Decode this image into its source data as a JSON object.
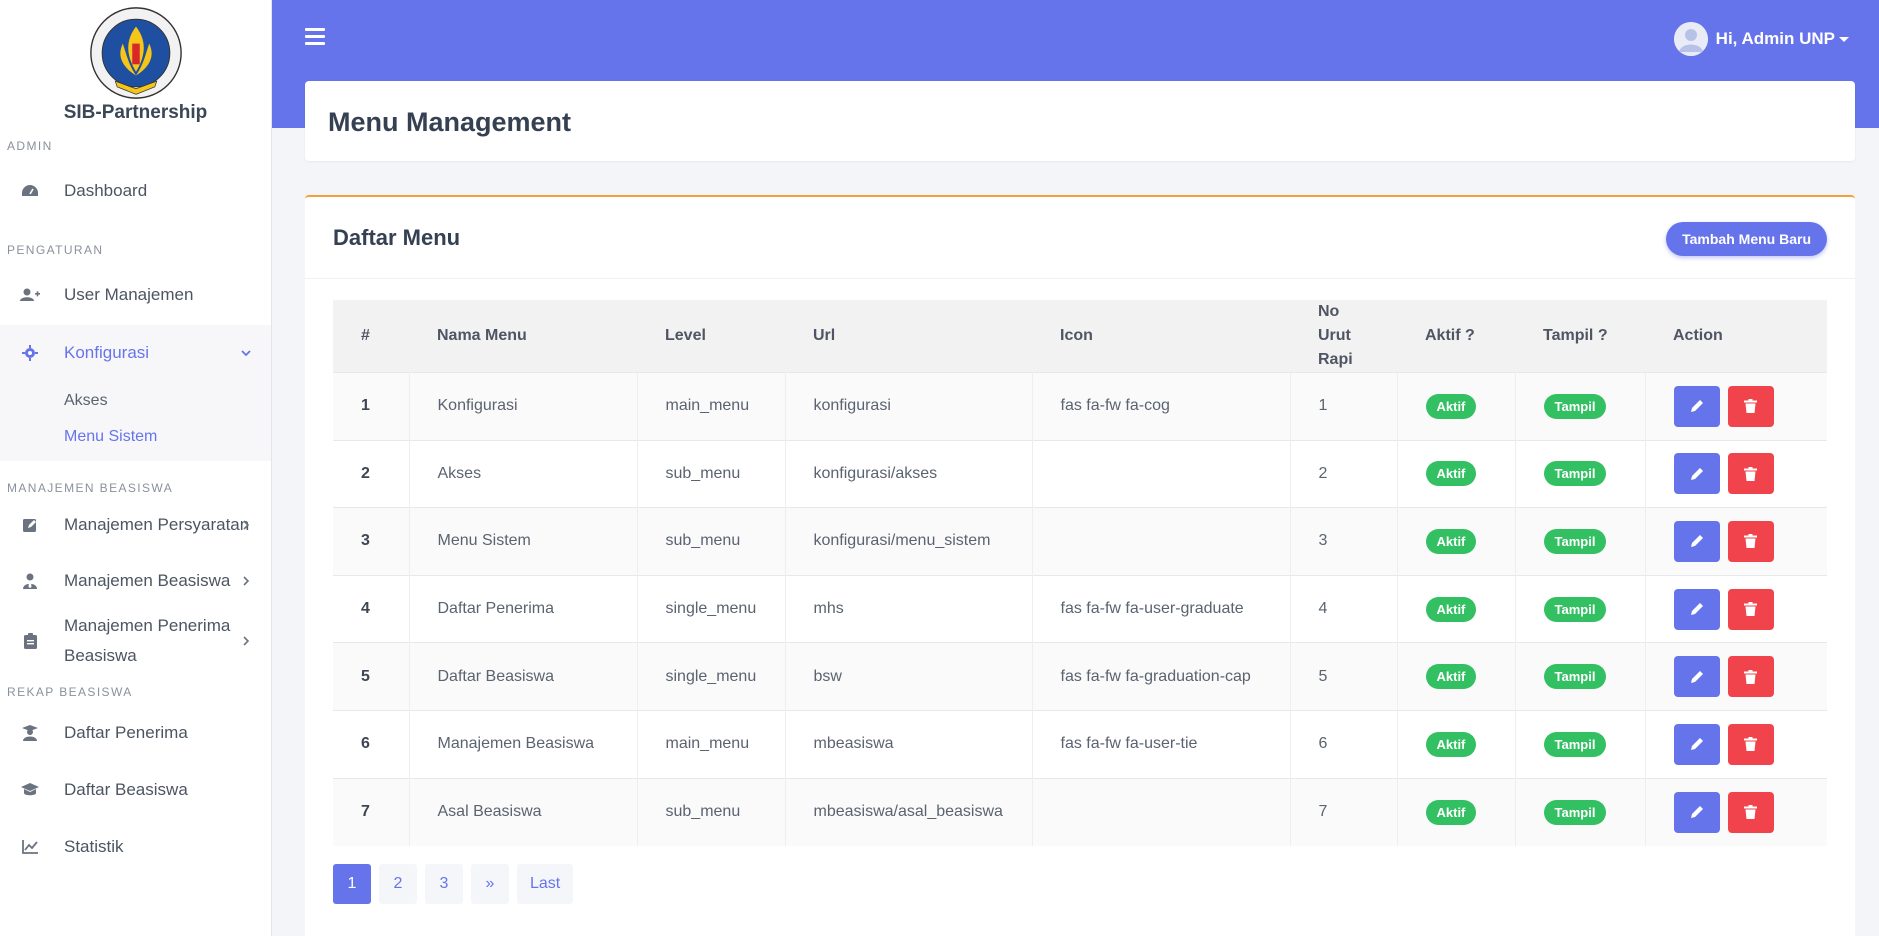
{
  "brand": {
    "name": "SIB-Partnership",
    "logo_text": "UNIVERSITAS NEGERI PADANG UNP"
  },
  "sidebar": {
    "sections": {
      "admin": "ADMIN",
      "pengaturan": "PENGATURAN",
      "manajemen_beasiswa": "MANAJEMEN BEASISWA",
      "rekap_beasiswa": "REKAP BEASISWA"
    },
    "items": {
      "dashboard": "Dashboard",
      "user_manajemen": "User Manajemen",
      "konfigurasi": "Konfigurasi",
      "akses": "Akses",
      "menu_sistem": "Menu Sistem",
      "manajemen_persyaratan": "Manajemen Persyaratan",
      "manajemen_beasiswa": "Manajemen Beasiswa",
      "manajemen_penerima_1": "Manajemen Penerima",
      "manajemen_penerima_2": "Beasiswa",
      "daftar_penerima": "Daftar Penerima",
      "daftar_beasiswa": "Daftar Beasiswa",
      "statistik": "Statistik"
    }
  },
  "topbar": {
    "user_greeting": "Hi, Admin UNP"
  },
  "page": {
    "title": "Menu Management"
  },
  "card": {
    "title": "Daftar Menu",
    "add_button": "Tambah Menu Baru"
  },
  "table": {
    "headers": {
      "num": "#",
      "nama": "Nama Menu",
      "level": "Level",
      "url": "Url",
      "icon": "Icon",
      "urut_1": "No",
      "urut_2": "Urut",
      "urut_3": "Rapi",
      "aktif": "Aktif ?",
      "tampil": "Tampil ?",
      "action": "Action"
    },
    "rows": [
      {
        "num": "1",
        "nama": "Konfigurasi",
        "level": "main_menu",
        "url": "konfigurasi",
        "icon": "fas fa-fw fa-cog",
        "urut": "1",
        "aktif": "Aktif",
        "tampil": "Tampil"
      },
      {
        "num": "2",
        "nama": "Akses",
        "level": "sub_menu",
        "url": "konfigurasi/akses",
        "icon": "",
        "urut": "2",
        "aktif": "Aktif",
        "tampil": "Tampil"
      },
      {
        "num": "3",
        "nama": "Menu Sistem",
        "level": "sub_menu",
        "url": "konfigurasi/menu_sistem",
        "icon": "",
        "urut": "3",
        "aktif": "Aktif",
        "tampil": "Tampil"
      },
      {
        "num": "4",
        "nama": "Daftar Penerima",
        "level": "single_menu",
        "url": "mhs",
        "icon": "fas fa-fw fa-user-graduate",
        "urut": "4",
        "aktif": "Aktif",
        "tampil": "Tampil"
      },
      {
        "num": "5",
        "nama": "Daftar Beasiswa",
        "level": "single_menu",
        "url": "bsw",
        "icon": "fas fa-fw fa-graduation-cap",
        "urut": "5",
        "aktif": "Aktif",
        "tampil": "Tampil"
      },
      {
        "num": "6",
        "nama": "Manajemen Beasiswa",
        "level": "main_menu",
        "url": "mbeasiswa",
        "icon": "fas fa-fw fa-user-tie",
        "urut": "6",
        "aktif": "Aktif",
        "tampil": "Tampil"
      },
      {
        "num": "7",
        "nama": "Asal Beasiswa",
        "level": "sub_menu",
        "url": "mbeasiswa/asal_beasiswa",
        "icon": "",
        "urut": "7",
        "aktif": "Aktif",
        "tampil": "Tampil"
      }
    ]
  },
  "pagination": {
    "p1": "1",
    "p2": "2",
    "p3": "3",
    "next": "»",
    "last": "Last"
  },
  "colors": {
    "primary": "#6674ec",
    "success": "#33c062",
    "danger": "#f1434b",
    "accent_border": "#f3a03b"
  }
}
